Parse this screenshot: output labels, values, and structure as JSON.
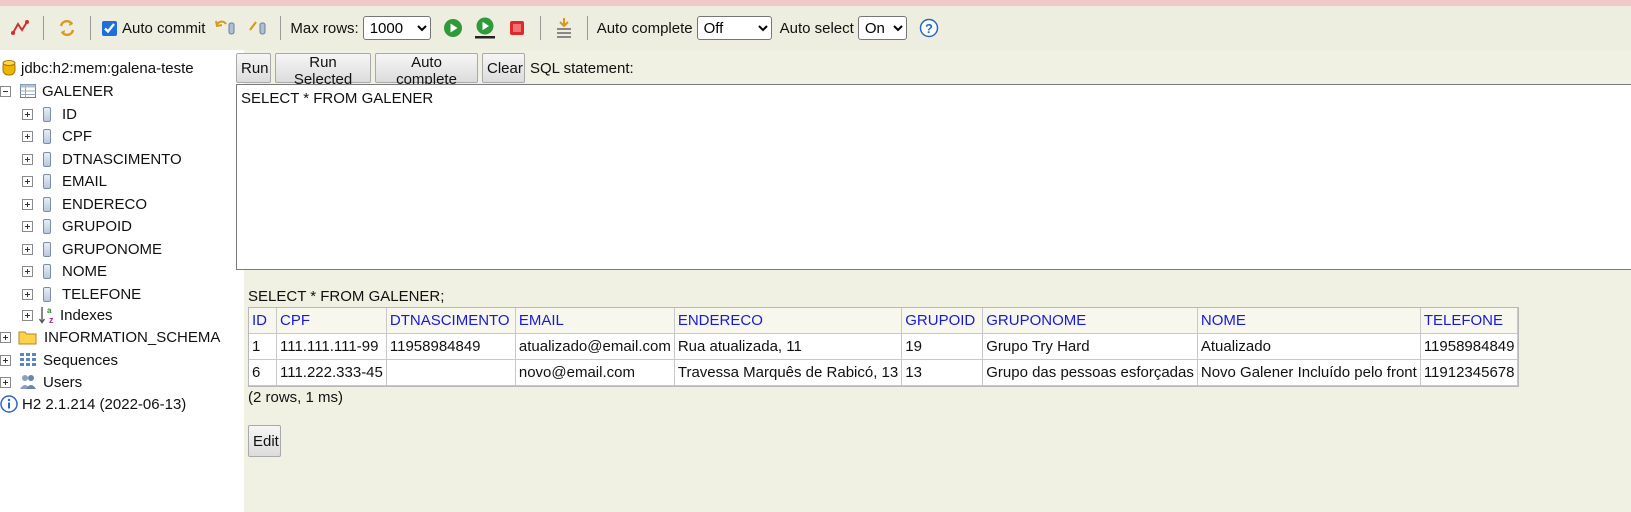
{
  "toolbar": {
    "auto_commit_label": "Auto commit",
    "max_rows_label": "Max rows:",
    "max_rows_value": "1000",
    "auto_complete_label": "Auto complete",
    "auto_complete_value": "Off",
    "auto_select_label": "Auto select",
    "auto_select_value": "On",
    "icons": [
      "disconnect-icon",
      "refresh-icon",
      "rollback-icon",
      "commit-icon",
      "run-icon",
      "run-selected-icon",
      "stop-icon",
      "history-icon",
      "help-icon"
    ]
  },
  "tree": {
    "connection": "jdbc:h2:mem:galena-teste",
    "table": "GALENER",
    "columns": [
      "ID",
      "CPF",
      "DTNASCIMENTO",
      "EMAIL",
      "ENDERECO",
      "GRUPOID",
      "GRUPONOME",
      "NOME",
      "TELEFONE"
    ],
    "indexes": "Indexes",
    "schema": "INFORMATION_SCHEMA",
    "sequences": "Sequences",
    "users": "Users",
    "version": "H2 2.1.214 (2022-06-13)"
  },
  "editor": {
    "run": "Run",
    "run_selected": "Run Selected",
    "auto_complete": "Auto complete",
    "clear": "Clear",
    "sql_label": "SQL statement:",
    "sql": "SELECT * FROM GALENER"
  },
  "result": {
    "query": "SELECT * FROM GALENER;",
    "headers": [
      "ID",
      "CPF",
      "DTNASCIMENTO",
      "EMAIL",
      "ENDERECO",
      "GRUPOID",
      "GRUPONOME",
      "NOME",
      "TELEFONE"
    ],
    "rows": [
      [
        "1",
        "111.111.111-99",
        "11958984849",
        "atualizado@email.com",
        "Rua atualizada, 11",
        "19",
        "Grupo Try Hard",
        "Atualizado",
        "11958984849"
      ],
      [
        "6",
        "111.222.333-45",
        "",
        "novo@email.com",
        "Travessa Marquês de Rabicó, 13",
        "13",
        "Grupo das pessoas esforçadas",
        "Novo Galener Incluído pelo front",
        "11912345678"
      ]
    ],
    "row_count": "(2 rows, 1 ms)",
    "edit": "Edit"
  },
  "colors": {
    "toolbar_bg": "#eeeee0",
    "panel_bg": "#f0f0e3",
    "header_text": "#1a1ad6"
  }
}
